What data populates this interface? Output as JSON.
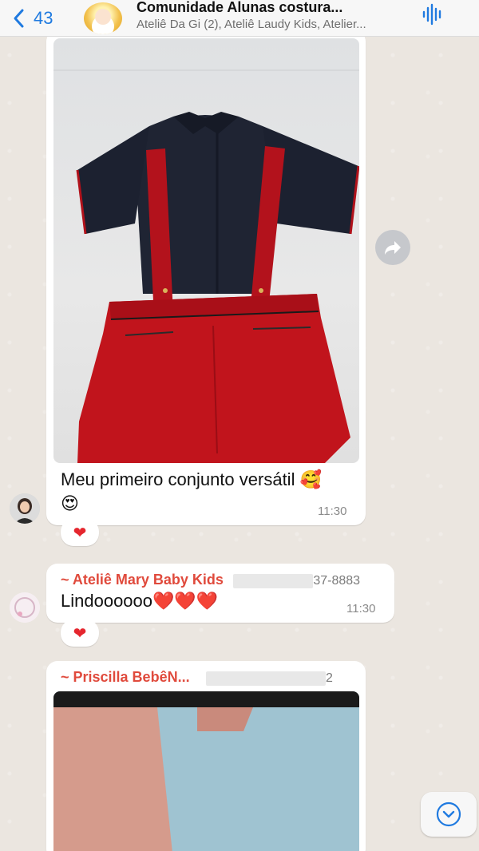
{
  "header": {
    "back_count": "43",
    "group_title": "Comunidade Alunas  costura...",
    "members_subtitle": "Ateliê Da Gi (2), Ateliê Laudy Kids, Atelier..."
  },
  "messages": [
    {
      "type": "image",
      "caption": "Meu primeiro conjunto versátil",
      "caption_emoji": "🥰",
      "caption_emoji_2": "😍",
      "time": "11:30",
      "reaction": "❤"
    },
    {
      "type": "text",
      "sender": "~ Ateliê Mary Baby Kids",
      "phone_suffix": "37-8883",
      "text": "Lindoooooo❤️❤️❤️",
      "time": "11:30",
      "reaction": "❤"
    },
    {
      "type": "image",
      "sender": "~ Priscilla BebêN...",
      "phone_suffix": "2"
    }
  ],
  "icons": {
    "back": "chevron-left-icon",
    "audio": "waveform-icon",
    "forward": "forward-arrow-icon",
    "scroll_down": "chevron-down-circle-icon"
  },
  "colors": {
    "accent": "#1f7ae0",
    "sender_name": "#e04a3c",
    "reaction_heart": "#e5262e",
    "outfit_shirt": "#1f2433",
    "outfit_shorts": "#c1141c"
  }
}
